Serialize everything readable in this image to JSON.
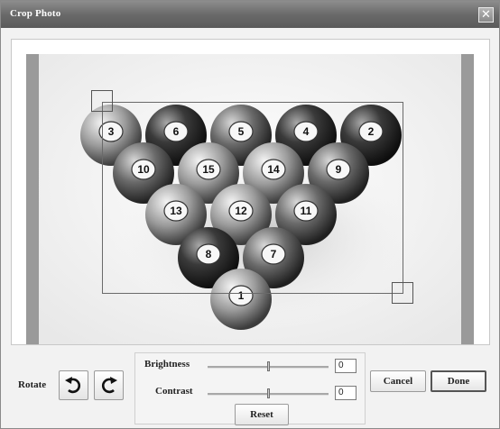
{
  "window": {
    "title": "Crop Photo",
    "close_glyph": "✕"
  },
  "controls": {
    "rotate_label": "Rotate",
    "rotate_left_icon": "rotate-left-icon",
    "rotate_right_icon": "rotate-right-icon",
    "brightness_label": "Brightness",
    "brightness_value": "0",
    "contrast_label": "Contrast",
    "contrast_value": "0",
    "reset_label": "Reset",
    "cancel_label": "Cancel",
    "done_label": "Done"
  },
  "photo": {
    "balls": [
      "3",
      "6",
      "5",
      "4",
      "2",
      "10",
      "15",
      "14",
      "9",
      "13",
      "12",
      "11",
      "8",
      "7",
      "1"
    ]
  },
  "colors": {
    "titlebar": "#6a6a6a",
    "side_bars": "#9a9a9a"
  }
}
